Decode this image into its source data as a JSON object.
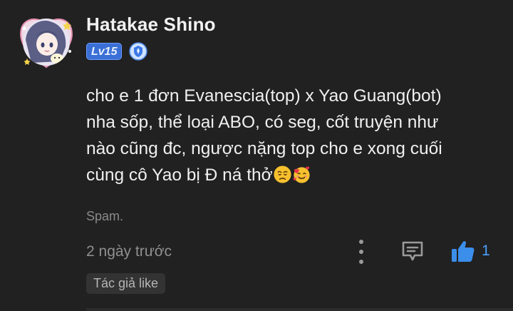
{
  "comment": {
    "username": "Hatakae Shino",
    "level_badge": "Lv15",
    "body_line1": "cho e 1 đơn Evanescia(top) x Yao Guang(bot)",
    "body_line2": "nha sốp, thể loại ABO, có seg, cốt truyện như",
    "body_line3": "nào cũng đc, ngược nặng top cho e xong cuối",
    "body_line4": "cùng cô Yao bị Đ ná thở",
    "note": "Spam.",
    "timestamp": "2 ngày trước",
    "like_count": "1",
    "author_like_label": "Tác giả like"
  },
  "icons": {
    "avatar": "avatar-anime-girl",
    "verify": "verified-shield-icon",
    "emoji1": "disappointed-face-emoji",
    "emoji2": "smiling-face-with-hearts-emoji",
    "more": "more-vertical-icon",
    "reply": "reply-comment-icon",
    "like": "thumbs-up-icon"
  },
  "colors": {
    "background": "#212121",
    "level_badge": "#3a6fd6",
    "like_accent": "#4aa0ff"
  }
}
